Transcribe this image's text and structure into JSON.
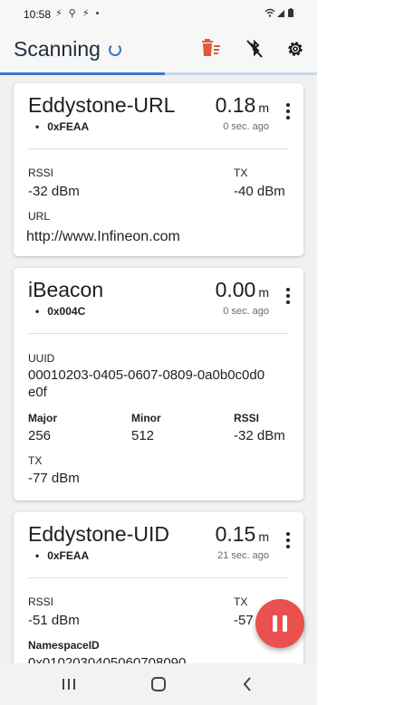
{
  "status_bar": {
    "time": "10:58",
    "left_icons": "⚡ ⚲ ⚡ •",
    "right_icons": "📶 ▮"
  },
  "app_bar": {
    "title": "Scanning",
    "scan_progress": 0.52
  },
  "colors": {
    "accent": "#3e75d0",
    "fab": "#e9504e",
    "delete": "#e05a3a"
  },
  "cards": [
    {
      "name": "Eddystone-URL",
      "distance": "0.18",
      "unit": "m",
      "service": "0xFEAA",
      "last_seen": "0 sec. ago",
      "rssi_label": "RSSI",
      "rssi_value": "-32 dBm",
      "tx_label": "TX",
      "tx_value": "-40 dBm",
      "url_label": "URL",
      "url_value": "http://www.Infineon.com"
    },
    {
      "name": "iBeacon",
      "distance": "0.00",
      "unit": "m",
      "service": "0x004C",
      "last_seen": "0 sec. ago",
      "uuid_label": "UUID",
      "uuid_line1": "00010203-0405-0607-0809-0a0b0c0d0",
      "uuid_line2": "e0f",
      "major_label": "Major",
      "major_value": "256",
      "minor_label": "Minor",
      "minor_value": "512",
      "rssi_label": "RSSI",
      "rssi_value": "-32 dBm",
      "tx_label": "TX",
      "tx_value": "-77 dBm"
    },
    {
      "name": "Eddystone-UID",
      "distance": "0.15",
      "unit": "m",
      "service": "0xFEAA",
      "last_seen": "21 sec. ago",
      "rssi_label": "RSSI",
      "rssi_value": "-51 dBm",
      "tx_label": "TX",
      "tx_value": "-57",
      "namespace_label": "NamespaceID",
      "namespace_value": "0x0102030405060708090"
    }
  ],
  "fab": {
    "icon": "pause-icon"
  },
  "nav_bar": {
    "icons": [
      "recent-apps-icon",
      "home-icon",
      "back-icon"
    ]
  }
}
